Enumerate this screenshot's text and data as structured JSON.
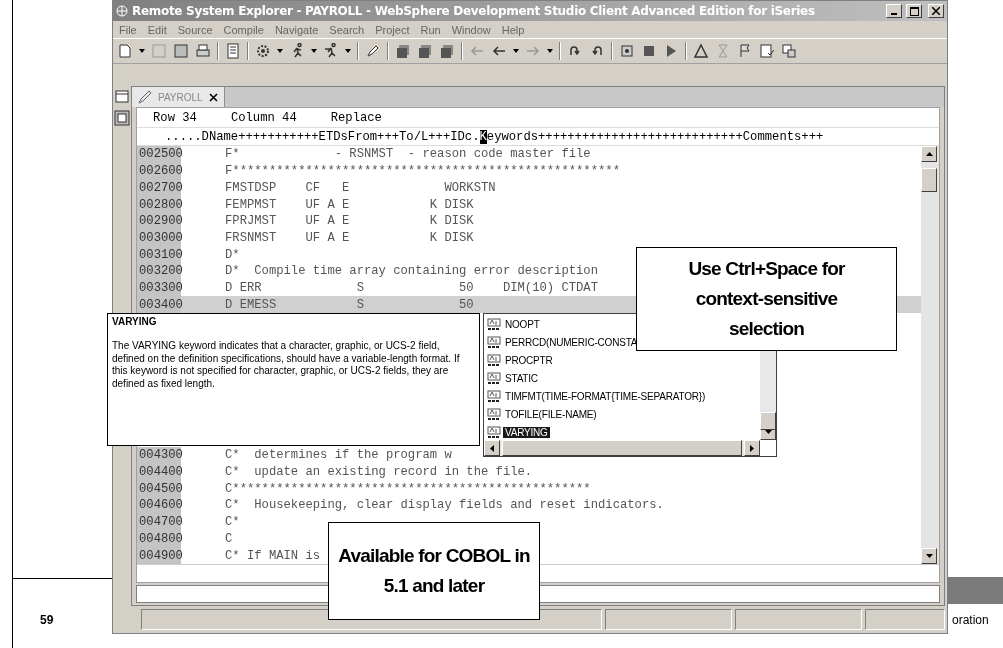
{
  "slide": {
    "page_number": "59",
    "footer_fragment": "oration"
  },
  "window": {
    "title": "Remote System Explorer - PAYROLL - WebSphere Development Studio Client Advanced Edition for iSeries",
    "active": false
  },
  "menu": [
    "File",
    "Edit",
    "Source",
    "Compile",
    "Navigate",
    "Search",
    "Project",
    "Run",
    "Window",
    "Help"
  ],
  "editor": {
    "tab": {
      "label": "PAYROLL",
      "selected": true
    },
    "status": {
      "row": "Row 34",
      "column": "Column 44",
      "mode": "Replace"
    },
    "ruler": {
      "before": ".....DName+++++++++++ETDsFrom+++To/L+++IDc.",
      "cursor": "K",
      "after": "eywords++++++++++++++++++++++++++++Comments+++"
    },
    "lines": [
      {
        "number": "002500",
        "text": "F*             - RSNMST  - reason code master file",
        "current": false
      },
      {
        "number": "002600",
        "text": "F*****************************************************",
        "current": false
      },
      {
        "number": "002700",
        "text": "FMSTDSP    CF   E             WORKSTN",
        "current": false
      },
      {
        "number": "002800",
        "text": "FEMPMST    UF A E           K DISK",
        "current": false
      },
      {
        "number": "002900",
        "text": "FPRJMST    UF A E           K DISK",
        "current": false
      },
      {
        "number": "003000",
        "text": "FRSNMST    UF A E           K DISK",
        "current": false
      },
      {
        "number": "003100",
        "text": "D*",
        "current": false
      },
      {
        "number": "003200",
        "text": "D*  Compile time array containing error description",
        "current": false
      },
      {
        "number": "003300",
        "text": "D ERR             S             50    DIM(10) CTDAT",
        "current": false
      },
      {
        "number": "003400",
        "text": "D EMESS           S             50",
        "current": true
      },
      {
        "number": "004300",
        "text": "C*  determines if the program w",
        "current": false
      },
      {
        "number": "004400",
        "text": "C*  update an existing record in the file.",
        "current": false
      },
      {
        "number": "004500",
        "text": "C*************************************************",
        "current": false
      },
      {
        "number": "004600",
        "text": "C*  Housekeeping, clear display fields and reset indicators.",
        "current": false
      },
      {
        "number": "004700",
        "text": "C*",
        "current": false
      },
      {
        "number": "004800",
        "text": "C",
        "current": false
      },
      {
        "number": "004900",
        "text": "C* If MAIN is",
        "current": false
      }
    ]
  },
  "help_popup": {
    "title": "VARYING",
    "body": "The VARYING keyword indicates that a character, graphic, or UCS-2 field, defined on the definition specifications, should have a variable-length format. If this keyword is not specified for character, graphic, or UCS-2 fields, they are defined as fixed length."
  },
  "completions": [
    {
      "label": "NOOPT",
      "selected": false
    },
    {
      "label": "PERRCD(NUMERIC-CONSTA",
      "selected": false
    },
    {
      "label": "PROCPTR",
      "selected": false
    },
    {
      "label": "STATIC",
      "selected": false
    },
    {
      "label": "TIMFMT(TIME-FORMAT{TIME-SEPARATOR})",
      "selected": false
    },
    {
      "label": "TOFILE(FILE-NAME)",
      "selected": false
    },
    {
      "label": "VARYING",
      "selected": true
    }
  ],
  "callouts": [
    "Use Ctrl+Space for context-sensitive selection",
    "Available for COBOL in 5.1 and later"
  ]
}
